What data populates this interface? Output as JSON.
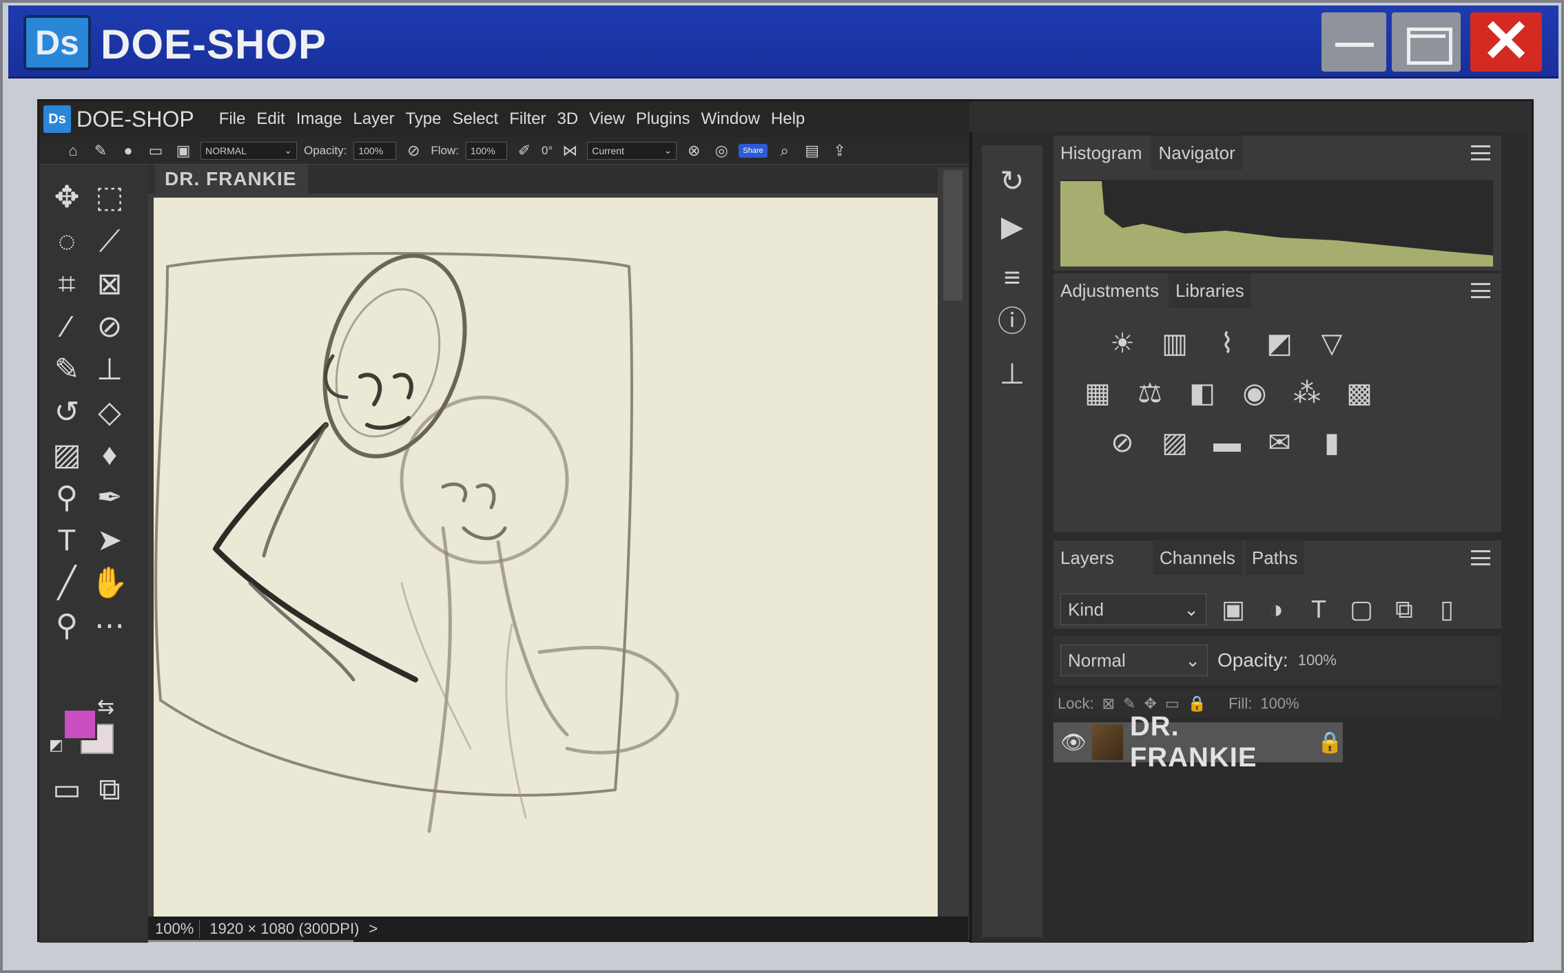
{
  "window": {
    "logo": "Ds",
    "title": "DOE-SHOP",
    "close_glyph": "✕"
  },
  "menubar": {
    "logo": "Ds",
    "app_name": "DOE-SHOP",
    "items": [
      "File",
      "Edit",
      "Image",
      "Layer",
      "Type",
      "Select",
      "Filter",
      "3D",
      "View",
      "Plugins",
      "Window",
      "Help"
    ]
  },
  "options_bar": {
    "mode": "NORMAL",
    "opacity_label": "Opacity:",
    "opacity_value": "100%",
    "flow_label": "Flow:",
    "flow_value": "100%",
    "angle_value": "0°",
    "sample": "Current",
    "share": "Share"
  },
  "document": {
    "tab_title": "DR. FRANKIE",
    "status": {
      "zoom": "100%",
      "size": "1920 × 1080 (300DPI)",
      "arrow": ">"
    }
  },
  "colors": {
    "foreground": "#c94ec1",
    "background": "#e6d9dc",
    "title_blue": "#1f3bb0",
    "close_red": "#d42a22"
  },
  "panels": {
    "histogram_tabs": [
      "Histogram",
      "Navigator"
    ],
    "adjust_tabs": [
      "Adjustments",
      "Libraries"
    ],
    "layers_tabs": [
      "Layers",
      "Channels",
      "Paths"
    ],
    "layers": {
      "kind": "Kind",
      "blend_mode": "Normal",
      "opacity_label": "Opacity:",
      "opacity_value": "100%",
      "lock_label": "Lock:",
      "fill_label": "Fill:",
      "fill_value": "100%",
      "items": [
        {
          "name": "DR. FRANKIE",
          "visible": true,
          "locked": true
        }
      ]
    }
  },
  "icons": {
    "tools": [
      "move-icon",
      "marquee-icon",
      "lasso-icon",
      "magic-wand-icon",
      "crop-icon",
      "frame-icon",
      "eyedropper-icon",
      "healing-icon",
      "brush-icon",
      "stamp-icon",
      "history-brush-icon",
      "eraser-icon",
      "gradient-icon",
      "blur-icon",
      "dodge-icon",
      "pen-icon",
      "type-icon",
      "path-select-icon",
      "line-icon",
      "hand-icon",
      "zoom-icon",
      "more-icon"
    ]
  }
}
